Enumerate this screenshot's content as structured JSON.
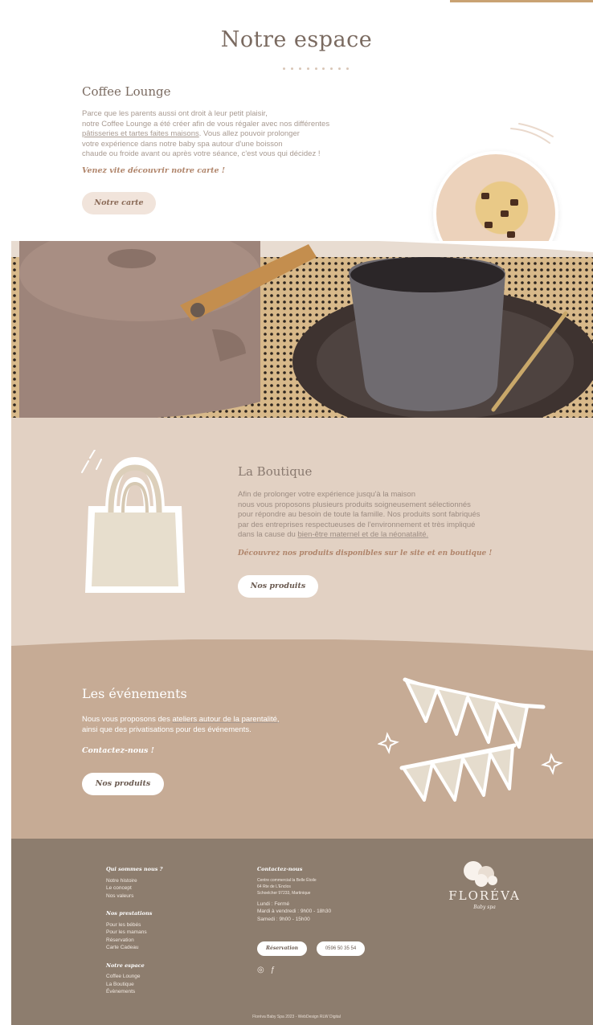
{
  "section": {
    "title": "Notre espace"
  },
  "coffee_lounge": {
    "title": "Coffee Lounge",
    "text_1": "Parce que les parents aussi ont droit à leur petit plaisir,",
    "text_2": "notre Coffee Lounge a été créer afin de vous régaler avec nos différentes",
    "text_3_link": "pâtisseries et tartes faites maisons",
    "text_3_rest": ". Vous allez pouvoir prolonger",
    "text_4": "votre expérience dans notre baby spa autour d'une boisson",
    "text_5": "chaude ou froide avant ou après votre séance, c'est vous qui décidez !",
    "cta": "Venez vite découvrir notre carte !",
    "button": "Notre carte"
  },
  "boutique": {
    "title": "La Boutique",
    "text_1": "Afin de prolonger votre expérience jusqu'à la maison",
    "text_2": "nous vous proposons plusieurs produits soigneusement sélectionnés",
    "text_3": "pour répondre au besoin de toute la famille. Nos produits sont fabriqués",
    "text_4": "par des entreprises respectueuses de l'environnement et très impliqué",
    "text_5_start": "dans la cause du ",
    "text_5_link": "bien-être maternel et de la néonatalité.",
    "cta": "Découvrez nos produits disponibles sur le site et en boutique !",
    "button": "Nos produits"
  },
  "events": {
    "title": "Les événements",
    "text_1_start": "Nous vous proposons des ",
    "text_1_link": "ateliers autour de la parentalité,",
    "text_2": "ainsi que des privatisations pour des événements.",
    "cta": "Contactez-nous !",
    "button": "Nos produits"
  },
  "footer": {
    "about": {
      "heading": "Qui sommes nous ?",
      "items": [
        "Notre histoire",
        "Le concept",
        "Nos valeurs"
      ]
    },
    "services": {
      "heading": "Nos prestations",
      "items": [
        "Pour les bébés",
        "Pour les mamans",
        "Réservation",
        "Carte Cadeau"
      ]
    },
    "space": {
      "heading": "Notre espace",
      "items": [
        "Coffee Lounge",
        "La Boutique",
        "Évènements"
      ]
    },
    "contact": {
      "heading": "Contactez-nous",
      "address_1": "Centre commercial la Belle Étoile",
      "address_2": "64 Rte de L'Enclos",
      "address_3": "Schoelcher 97233, Martinique",
      "hours_1": "Lundi : Fermé",
      "hours_2": "Mardi à vendredi : 9h00 - 18h30",
      "hours_3": "Samedi : 9h00 - 15h00",
      "book_button": "Réservation",
      "phone_button": "0596 50 35 54"
    },
    "logo_name": "FLORÉVA",
    "logo_tagline": "Baby spa",
    "copyright": "Floréva Baby Spa 2023 - WebDesign RLW Digital"
  },
  "icons": [
    "instagram-icon",
    "facebook-icon"
  ],
  "colors": {
    "title": "#7a6a60",
    "accent": "#b0856b",
    "boutique_bg": "#e2d1c3",
    "events_bg": "#c6ab95",
    "footer_bg": "#8d7d6e"
  }
}
